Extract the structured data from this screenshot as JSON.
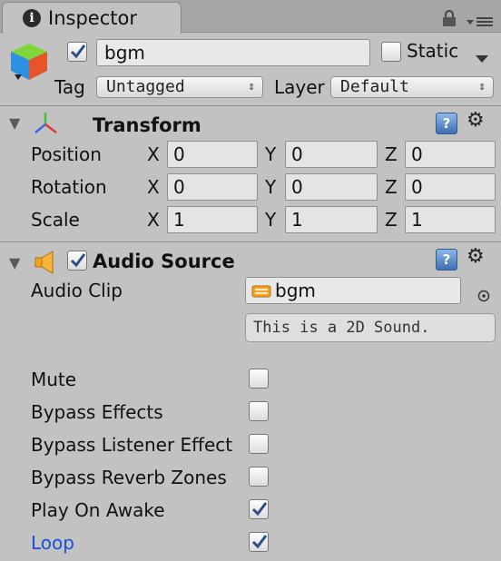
{
  "tab": {
    "title": "Inspector",
    "info_icon": "info-icon"
  },
  "object": {
    "name": "bgm",
    "active": true,
    "static_label": "Static",
    "static": false,
    "tag_label": "Tag",
    "tag_value": "Untagged",
    "layer_label": "Layer",
    "layer_value": "Default"
  },
  "transform": {
    "title": "Transform",
    "rows": [
      {
        "label": "Position",
        "x": "0",
        "y": "0",
        "z": "0"
      },
      {
        "label": "Rotation",
        "x": "0",
        "y": "0",
        "z": "0"
      },
      {
        "label": "Scale",
        "x": "1",
        "y": "1",
        "z": "1"
      }
    ],
    "axes": {
      "x": "X",
      "y": "Y",
      "z": "Z"
    }
  },
  "audio": {
    "title": "Audio Source",
    "enabled": true,
    "clip_label": "Audio Clip",
    "clip_value": "bgm",
    "hint": "This is a 2D Sound.",
    "options": [
      {
        "label": "Mute",
        "checked": false
      },
      {
        "label": "Bypass Effects",
        "checked": false
      },
      {
        "label": "Bypass Listener Effect",
        "checked": false
      },
      {
        "label": "Bypass Reverb Zones",
        "checked": false
      },
      {
        "label": "Play On Awake",
        "checked": true
      },
      {
        "label": "Loop",
        "checked": true
      }
    ]
  },
  "colors": {
    "panel_bg": "#c2c2c2",
    "tab_bar": "#a6a6a6",
    "checkmark": "#2c4f8a",
    "loop_label": "#1c4fd9",
    "help_blue": "#3e6fb0"
  },
  "icons": [
    "info-icon",
    "lock-icon",
    "menu-icon",
    "cube-icon",
    "transform-axes-icon",
    "speaker-icon",
    "audio-clip-icon",
    "help-icon",
    "gear-icon",
    "object-picker-icon"
  ]
}
